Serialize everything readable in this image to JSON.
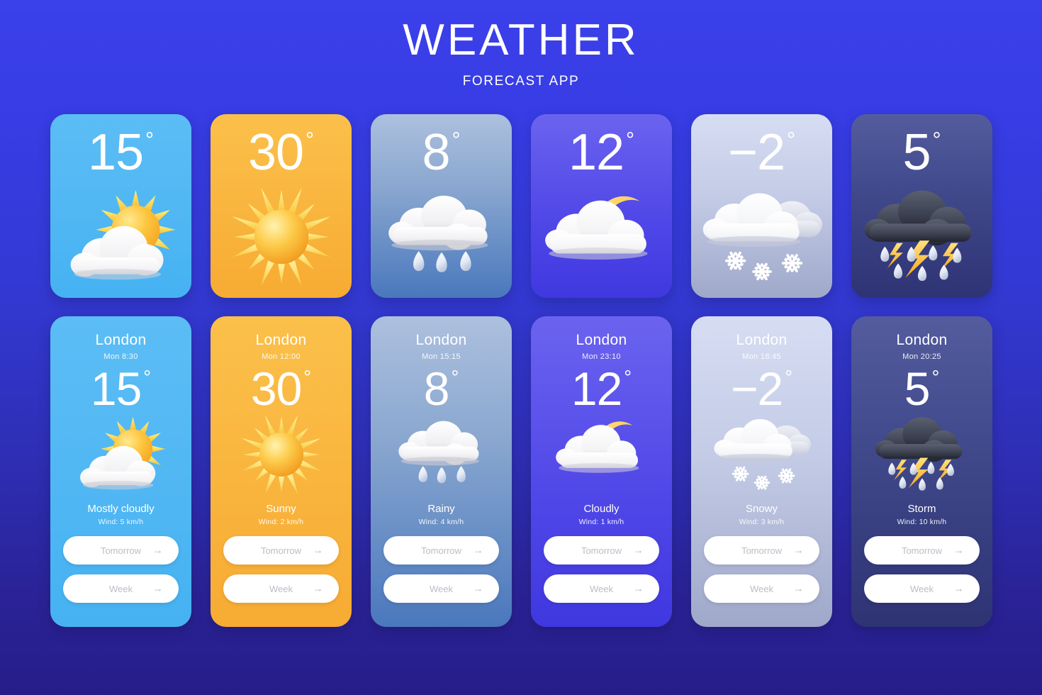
{
  "header": {
    "title": "WEATHER",
    "subtitle": "FORECAST APP"
  },
  "theme": {
    "background_top": "#3b40ea",
    "background_bottom": "#261d8a",
    "button_bg": "#ffffff",
    "button_text": "#bcbcc6"
  },
  "buttons": {
    "tomorrow_label": "Tomorrow",
    "week_label": "Week",
    "arrow_glyph": "→"
  },
  "degree_symbol": "°",
  "cards": [
    {
      "city": "London",
      "time": "Mon 8:30",
      "temp": "15",
      "condition": "Mostly cloudly",
      "wind": "Wind: 5 km/h",
      "icon": "sun-behind-cloud-icon",
      "theme_class": "bg-sunnycloud",
      "accent": "#46b2f2"
    },
    {
      "city": "London",
      "time": "Mon 12:00",
      "temp": "30",
      "condition": "Sunny",
      "wind": "Wind: 2 km/h",
      "icon": "sun-icon",
      "theme_class": "bg-sunny",
      "accent": "#f7ab33"
    },
    {
      "city": "London",
      "time": "Mon 15:15",
      "temp": "8",
      "condition": "Rainy",
      "wind": "Wind: 4 km/h",
      "icon": "cloud-rain-icon",
      "theme_class": "bg-rainy",
      "accent": "#4a78bd"
    },
    {
      "city": "London",
      "time": "Mon 23:10",
      "temp": "12",
      "condition": "Cloudly",
      "wind": "Wind: 1 km/h",
      "icon": "moon-behind-cloud-icon",
      "theme_class": "bg-cloudy",
      "accent": "#4038e0"
    },
    {
      "city": "London",
      "time": "Mon 18:45",
      "temp": "−2",
      "condition": "Snowy",
      "wind": "Wind: 3 km/h",
      "icon": "cloud-snow-icon",
      "theme_class": "bg-snowy",
      "accent": "#9fa8c9"
    },
    {
      "city": "London",
      "time": "Mon 20:25",
      "temp": "5",
      "condition": "Storm",
      "wind": "Wind: 10 km/h",
      "icon": "cloud-lightning-icon",
      "theme_class": "bg-storm",
      "accent": "#2e3374"
    }
  ]
}
